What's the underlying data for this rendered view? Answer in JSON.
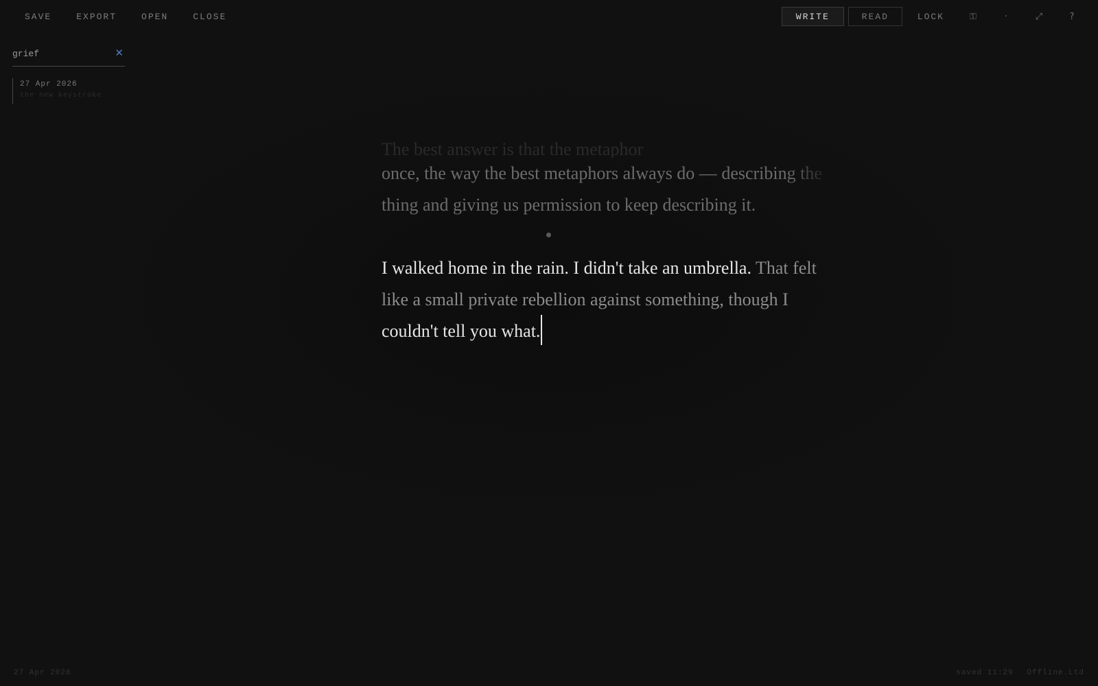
{
  "toolbar": {
    "save_label": "SAVE",
    "export_label": "EXPORT",
    "open_label": "OPEN",
    "close_label": "CLOSE",
    "write_label": "WRITE",
    "read_label": "READ",
    "lock_label": "LOCK",
    "icons": {
      "key": "⚿",
      "dot": "·",
      "expand": "⤢",
      "help": "?"
    }
  },
  "search": {
    "value": "grief",
    "clear_glyph": "✕"
  },
  "results": [
    {
      "date": "27 Apr 2026",
      "snippet": "the new keystroke"
    }
  ],
  "editor": {
    "prev_partial_line": "The best answer is that the metaphor",
    "prev_line_2_a": "once, the way the best metaphors always do — ",
    "prev_line_2_b": "describing the",
    "prev_line_3": "thing and giving us permission to keep describing it.",
    "current_a": "I walked home in the rain. I didn't take an umbrella.",
    "current_b": " That felt",
    "current_c": "like a small private rebellion against something, though I",
    "current_d": "couldn't tell you what."
  },
  "footer": {
    "date": "27 Apr 2026",
    "saved": "saved 11:29",
    "status": "Offline.Ltd"
  },
  "colors": {
    "background": "#101010",
    "accent": "#4d7bc2",
    "text_current": "#e6e6e6",
    "text_previous": "#6c6c6c"
  }
}
